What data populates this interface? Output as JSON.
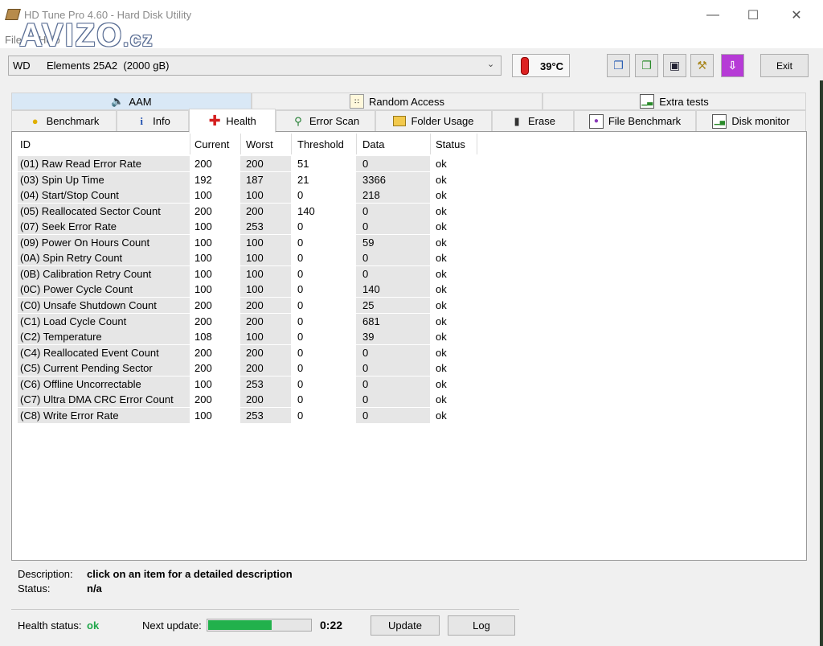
{
  "window": {
    "title": "HD Tune Pro 4.60 - Hard Disk Utility"
  },
  "menu": {
    "file": "File",
    "help": "Help"
  },
  "watermark": {
    "text": "AVIZO",
    "suffix": ".cz"
  },
  "drive": {
    "vendor": "WD",
    "name": "Elements 25A2  (2000 gB)"
  },
  "temperature": "39°C",
  "toolbar": {
    "exit_label": "Exit"
  },
  "tabs_top": [
    {
      "label": "AAM",
      "icon": "speaker-icon"
    },
    {
      "label": "Random Access",
      "icon": "scatter-icon"
    },
    {
      "label": "Extra tests",
      "icon": "chart-icon"
    }
  ],
  "tabs": [
    {
      "label": "Benchmark",
      "icon": "lightbulb-icon"
    },
    {
      "label": "Info",
      "icon": "info-icon"
    },
    {
      "label": "Health",
      "icon": "health-cross-icon"
    },
    {
      "label": "Error Scan",
      "icon": "magnifier-icon"
    },
    {
      "label": "Folder Usage",
      "icon": "folder-icon"
    },
    {
      "label": "Erase",
      "icon": "trash-icon"
    },
    {
      "label": "File Benchmark",
      "icon": "file-icon"
    },
    {
      "label": "Disk monitor",
      "icon": "monitor-chart-icon"
    }
  ],
  "table": {
    "columns": [
      "ID",
      "Current",
      "Worst",
      "Threshold",
      "Data",
      "Status"
    ],
    "rows": [
      [
        "(01) Raw Read Error Rate",
        "200",
        "200",
        "51",
        "0",
        "ok"
      ],
      [
        "(03) Spin Up Time",
        "192",
        "187",
        "21",
        "3366",
        "ok"
      ],
      [
        "(04) Start/Stop Count",
        "100",
        "100",
        "0",
        "218",
        "ok"
      ],
      [
        "(05) Reallocated Sector Count",
        "200",
        "200",
        "140",
        "0",
        "ok"
      ],
      [
        "(07) Seek Error Rate",
        "100",
        "253",
        "0",
        "0",
        "ok"
      ],
      [
        "(09) Power On Hours Count",
        "100",
        "100",
        "0",
        "59",
        "ok"
      ],
      [
        "(0A) Spin Retry Count",
        "100",
        "100",
        "0",
        "0",
        "ok"
      ],
      [
        "(0B) Calibration Retry Count",
        "100",
        "100",
        "0",
        "0",
        "ok"
      ],
      [
        "(0C) Power Cycle Count",
        "100",
        "100",
        "0",
        "140",
        "ok"
      ],
      [
        "(C0) Unsafe Shutdown Count",
        "200",
        "200",
        "0",
        "25",
        "ok"
      ],
      [
        "(C1) Load Cycle Count",
        "200",
        "200",
        "0",
        "681",
        "ok"
      ],
      [
        "(C2) Temperature",
        "108",
        "100",
        "0",
        "39",
        "ok"
      ],
      [
        "(C4) Reallocated Event Count",
        "200",
        "200",
        "0",
        "0",
        "ok"
      ],
      [
        "(C5) Current Pending Sector",
        "200",
        "200",
        "0",
        "0",
        "ok"
      ],
      [
        "(C6) Offline Uncorrectable",
        "100",
        "253",
        "0",
        "0",
        "ok"
      ],
      [
        "(C7) Ultra DMA CRC Error Count",
        "200",
        "200",
        "0",
        "0",
        "ok"
      ],
      [
        "(C8) Write Error Rate",
        "100",
        "253",
        "0",
        "0",
        "ok"
      ]
    ]
  },
  "details": {
    "description_label": "Description:",
    "description_value": "click on an item for a detailed description",
    "status_label": "Status:",
    "status_value": "n/a"
  },
  "footer": {
    "health_label": "Health status:",
    "health_value": "ok",
    "next_update_label": "Next update:",
    "progress_fraction": 0.62,
    "countdown": "0:22",
    "update_label": "Update",
    "log_label": "Log"
  },
  "colors": {
    "health_ok": "#1fa64a",
    "progress": "#22b14c",
    "tab_selected": "#d9e8f6"
  }
}
